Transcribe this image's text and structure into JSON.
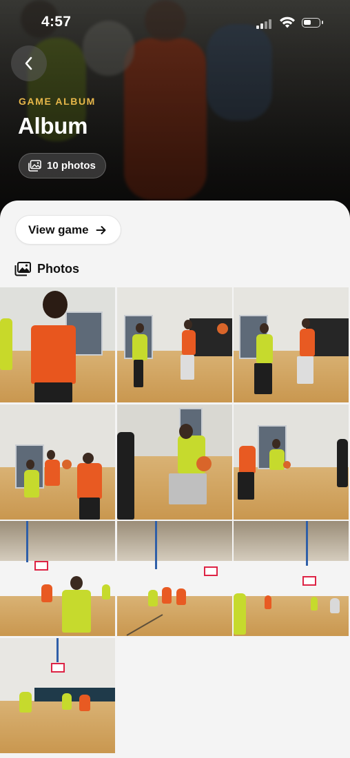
{
  "status_bar": {
    "time": "4:57"
  },
  "header": {
    "eyebrow": "GAME ALBUM",
    "title": "Album",
    "photo_count_label": "10 photos"
  },
  "actions": {
    "view_game_label": "View game"
  },
  "photos_section": {
    "title": "Photos"
  },
  "icons": {
    "back": "chevron-left-icon",
    "photo_count": "photos-icon",
    "view_game": "arrow-right-icon",
    "section": "photos-stack-icon",
    "status": [
      "signal-icon",
      "wifi-icon",
      "battery-icon"
    ]
  },
  "colors": {
    "accent": "#e8b84a",
    "sheet_bg": "#f4f4f4"
  },
  "photos": [
    {
      "kind": "closeup-orange"
    },
    {
      "kind": "two-players-pass"
    },
    {
      "kind": "two-players-drive"
    },
    {
      "kind": "three-players"
    },
    {
      "kind": "dribble-closeup"
    },
    {
      "kind": "group-jump"
    },
    {
      "kind": "wide-gym-left"
    },
    {
      "kind": "wide-gym-center"
    },
    {
      "kind": "wide-gym-right"
    },
    {
      "kind": "wide-gym-hoop"
    }
  ]
}
